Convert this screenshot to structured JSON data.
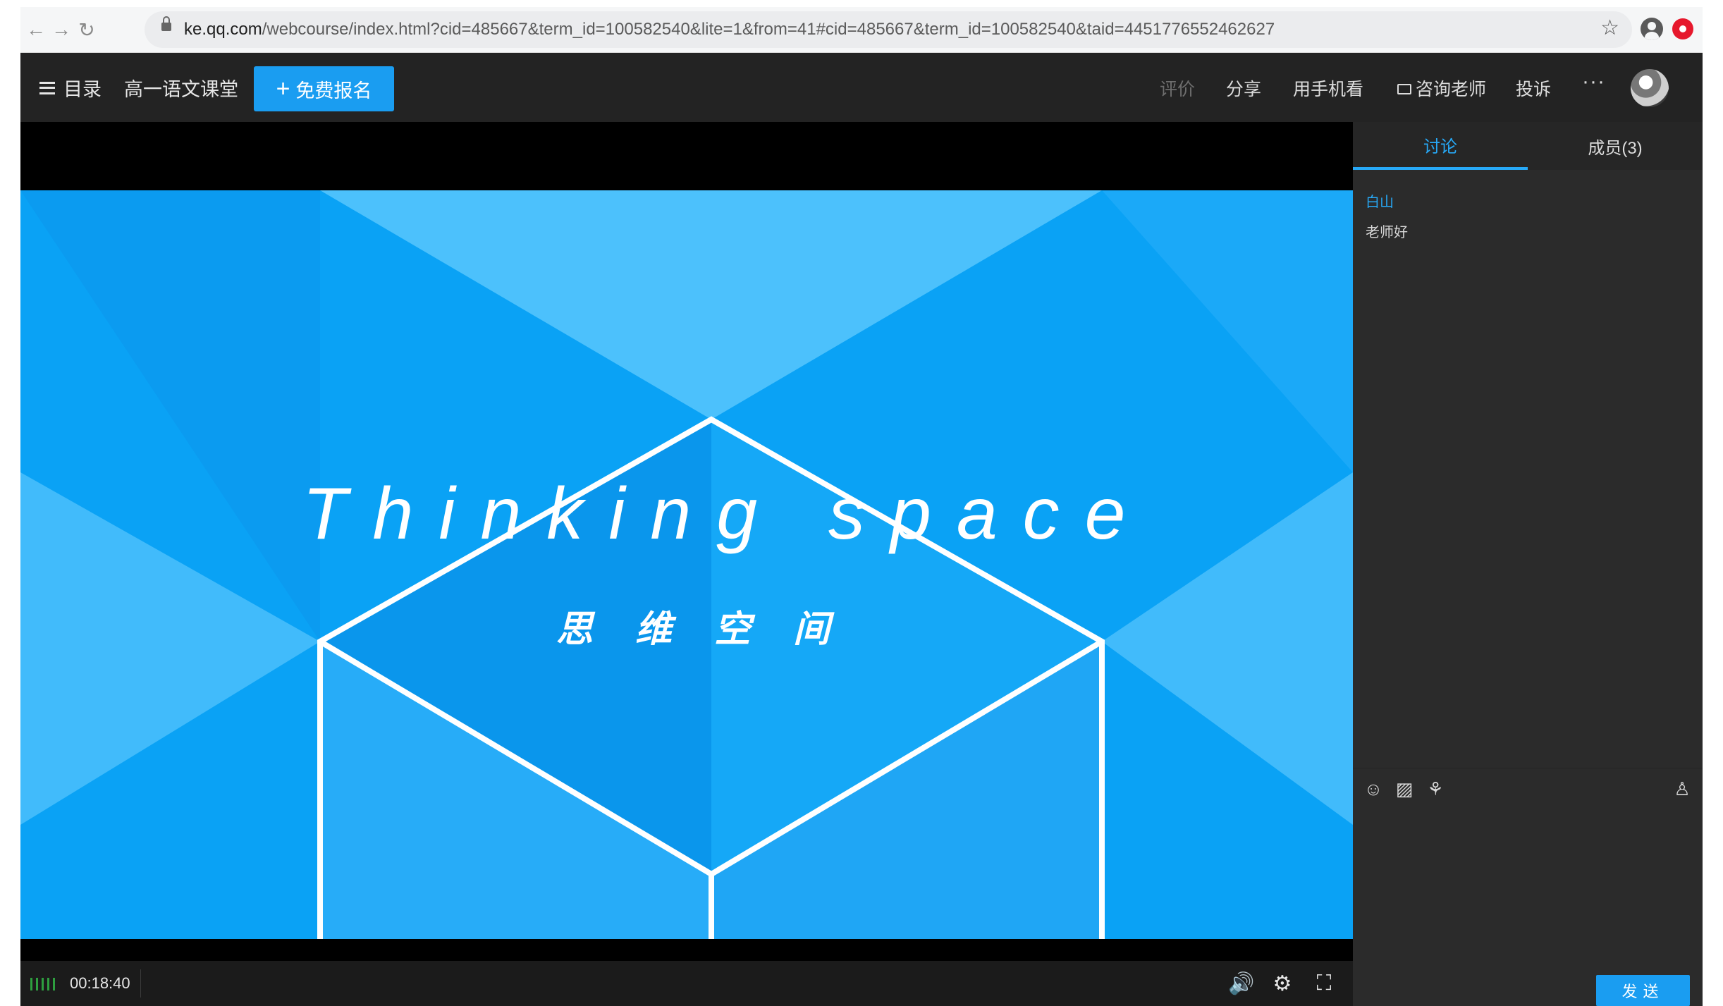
{
  "browser": {
    "url_host": "ke.qq.com",
    "url_path": "/webcourse/index.html?cid=485667&term_id=100582540&lite=1&from=41#cid=485667&term_id=100582540&taid=4451776552462627"
  },
  "topbar": {
    "menu_label": "目录",
    "course_title": "高一语文课堂",
    "enroll_label": "免费报名",
    "links": {
      "rate": "评价",
      "share": "分享",
      "mobile": "用手机看",
      "consult": "咨询老师",
      "report": "投诉"
    }
  },
  "slide": {
    "title": "Thinking space",
    "subtitle": "思维空间"
  },
  "player": {
    "time": "00:18:40"
  },
  "panel": {
    "tabs": [
      "讨论",
      "成员(3)"
    ],
    "messages": [
      {
        "user": "白山",
        "text": "老师好"
      }
    ],
    "send_label": "发送"
  },
  "colors": {
    "accent": "#1a9df1",
    "slide_bg": "#0aa2f5",
    "bar_bg": "#232323"
  }
}
